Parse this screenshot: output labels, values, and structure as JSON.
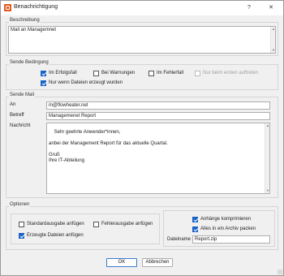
{
  "titlebar": {
    "title": "Benachrichtigung",
    "help_label": "?",
    "close_label": "✕"
  },
  "beschreibung": {
    "group_label": "Beschreibung",
    "value": "Mail an Managemnet"
  },
  "sende_bedingung": {
    "group_label": "Sende Bedingung",
    "options": [
      {
        "label": "Im Erfolgsfall",
        "checked": true,
        "disabled": false
      },
      {
        "label": "Bei Warnungen",
        "checked": false,
        "disabled": false
      },
      {
        "label": "Im Fehlerfall",
        "checked": false,
        "disabled": false
      },
      {
        "label": "Nur beim ersten auftreten",
        "checked": false,
        "disabled": true
      }
    ],
    "only_new_files": {
      "label": "Nur wenn Dateien erzeugt wurden",
      "checked": true
    }
  },
  "sende_mail": {
    "group_label": "Sende Mail",
    "an_label": "An",
    "an_value": "m@flowheater.net",
    "betreff_label": "Betreff",
    "betreff_value": "Managemenet Report",
    "nachricht_label": "Nachricht",
    "nachricht_value": "Sehr geehrte Anwender*innen,\n\nanbei der Management Report für das aktuelle Quartal.\n\nGruß\nIhre IT-Abteilung"
  },
  "optionen": {
    "group_label": "Optionen",
    "standardausgabe": {
      "label": "Standardausgabe anfügen",
      "checked": false
    },
    "fehlerausgabe": {
      "label": "Fehlerausgabe anfügen",
      "checked": false
    },
    "erzeugte_dateien": {
      "label": "Erzeugte Dateien anfügen",
      "checked": true
    },
    "anhaenge_komprimieren": {
      "label": "Anhänge komprimieren",
      "checked": true
    },
    "archiv_packen": {
      "label": "Alles in ein Archiv packen",
      "checked": true
    },
    "dateiname_label": "Dateiname",
    "dateiname_value": "Report.zip"
  },
  "footer": {
    "ok_label": "OK",
    "cancel_label": "Abbrechen"
  },
  "colors": {
    "accent": "#1a63c6",
    "app_icon": "#e2581f"
  }
}
